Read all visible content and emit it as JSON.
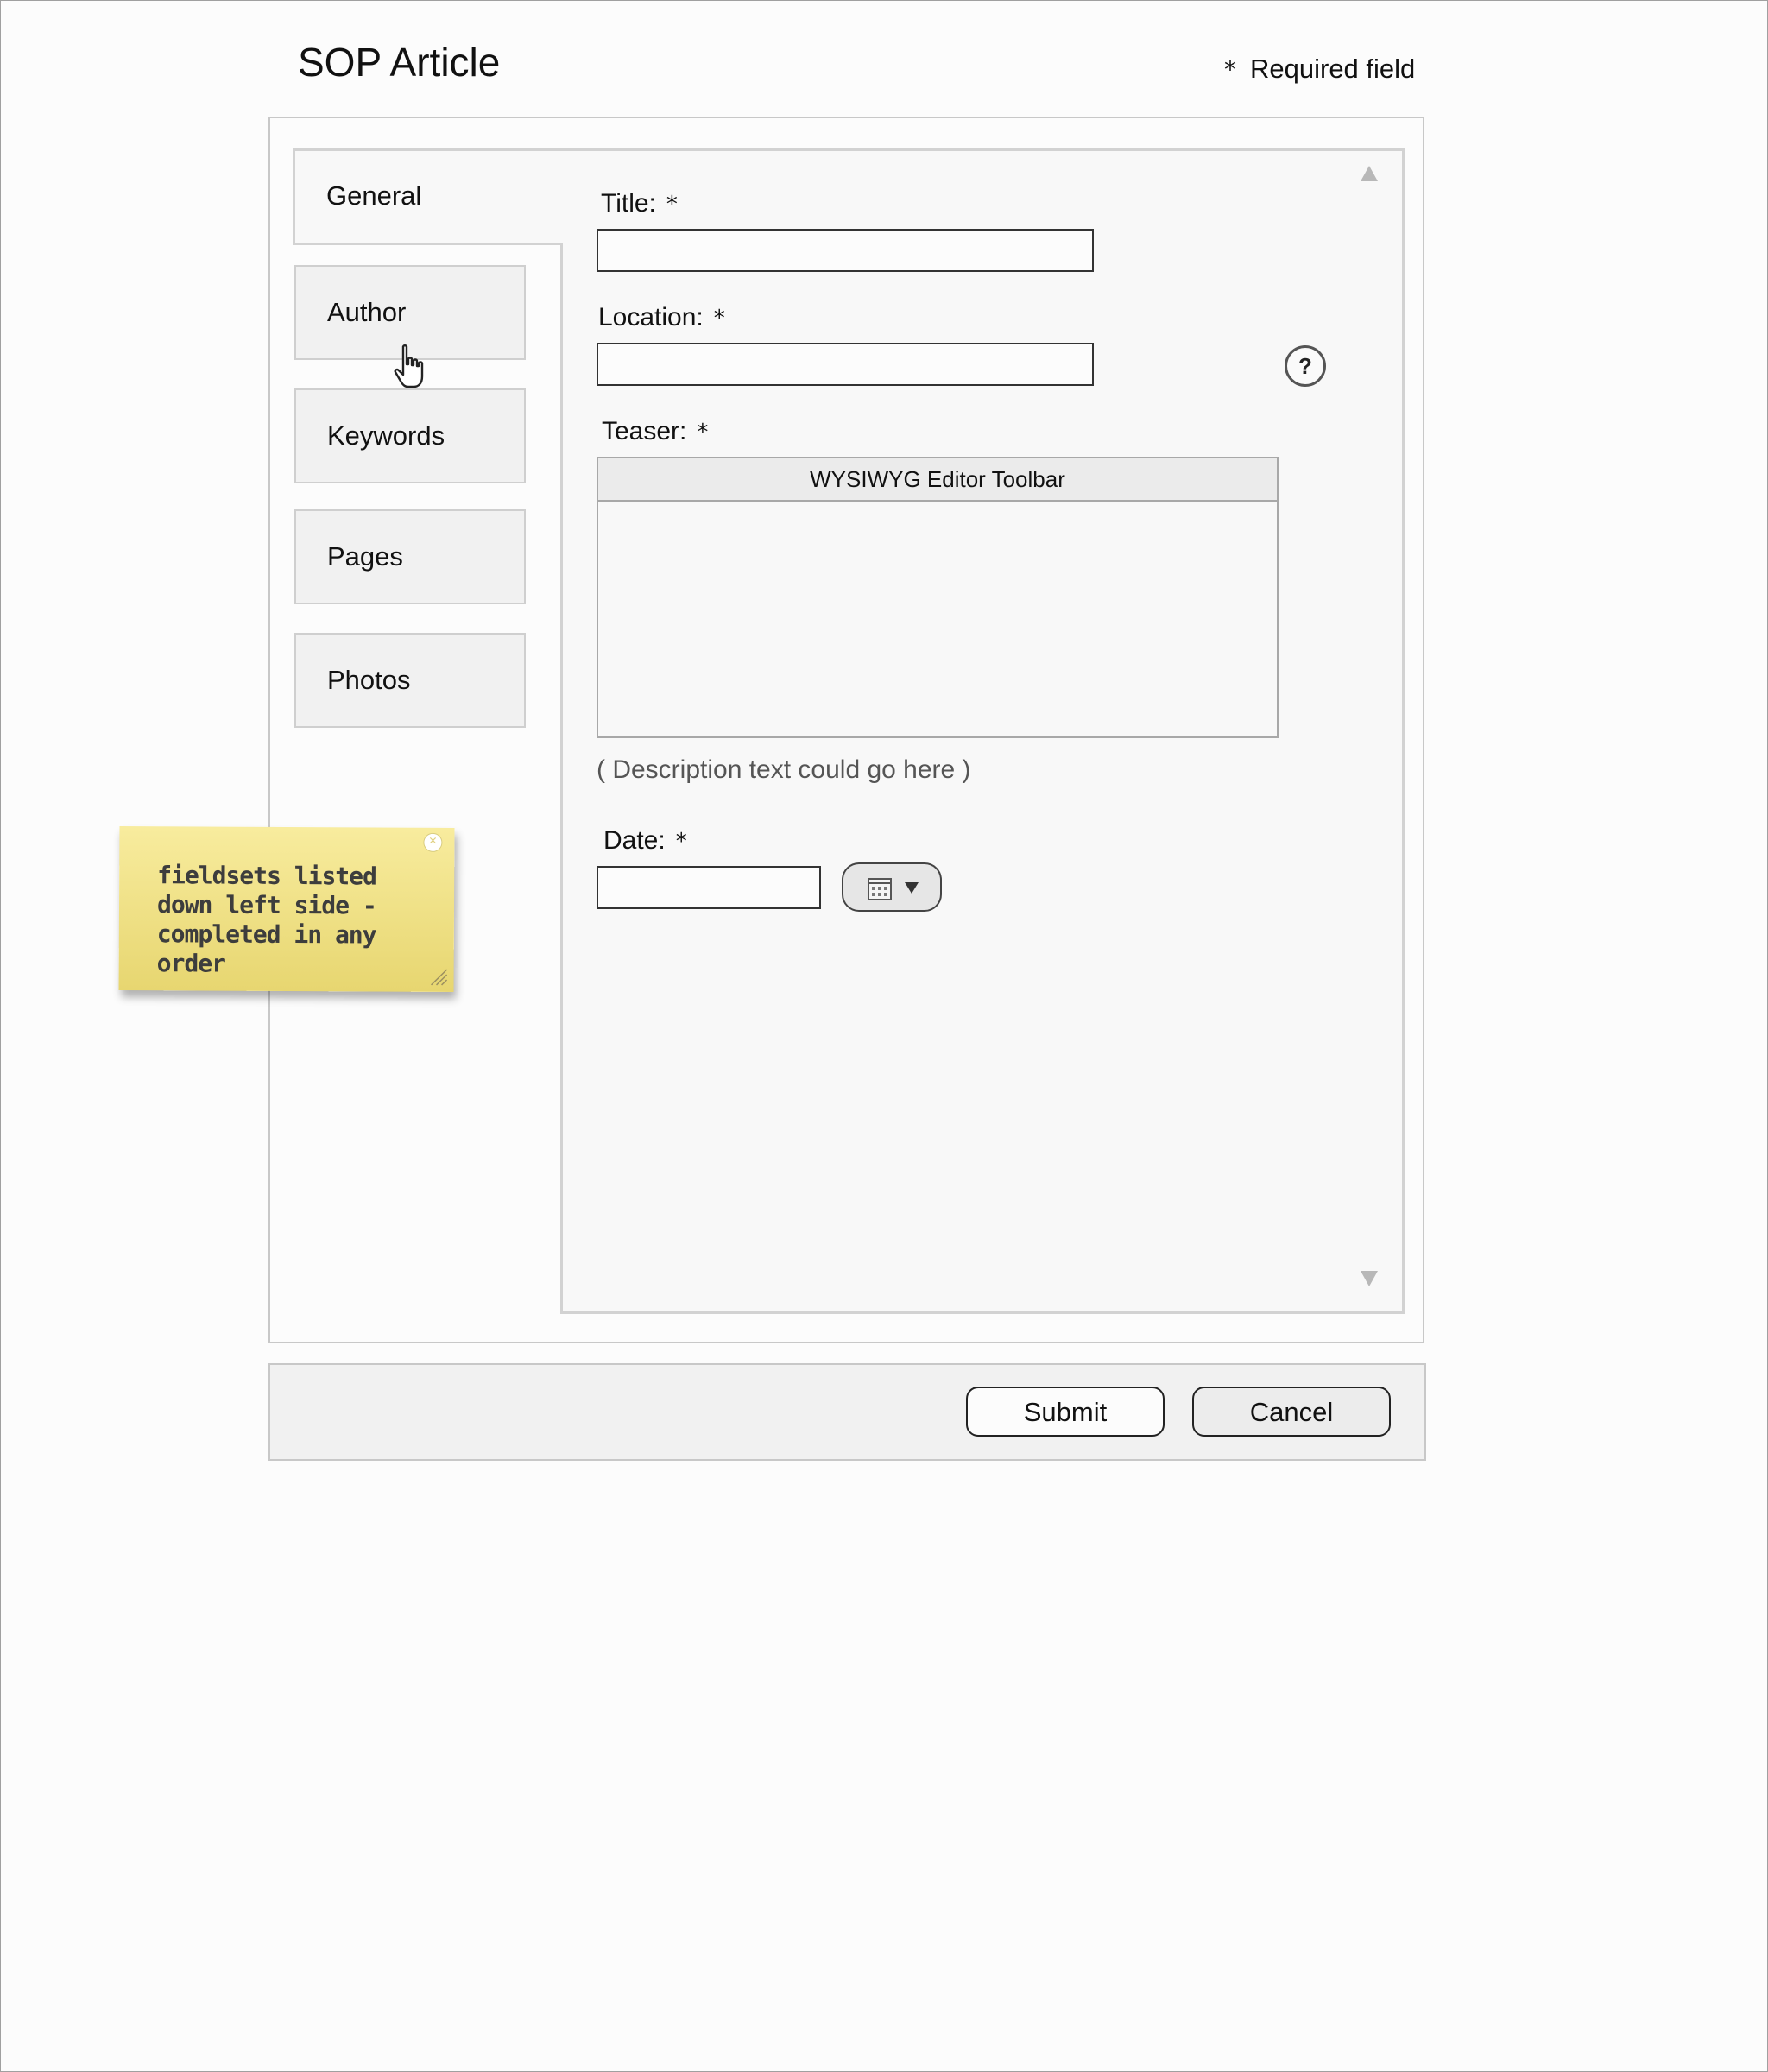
{
  "page": {
    "title": "SOP Article",
    "required_note_symbol": "*",
    "required_note": "Required field"
  },
  "tabs": [
    {
      "label": "General",
      "active": true
    },
    {
      "label": "Author",
      "active": false
    },
    {
      "label": "Keywords",
      "active": false
    },
    {
      "label": "Pages",
      "active": false
    },
    {
      "label": "Photos",
      "active": false
    }
  ],
  "form": {
    "title_label": "Title:",
    "title_value": "",
    "location_label": "Location:",
    "location_value": "",
    "teaser_label": "Teaser:",
    "editor_toolbar": "WYSIWYG Editor Toolbar",
    "description": "( Description text could go here )",
    "date_label": "Date:",
    "date_value": "",
    "required_symbol": "*",
    "help_symbol": "?"
  },
  "buttons": {
    "submit": "Submit",
    "cancel": "Cancel"
  },
  "sticky_note": {
    "text": "fieldsets listed down left side - completed in any order"
  },
  "icons": {
    "help": "question-mark-icon",
    "calendar": "calendar-icon",
    "caret": "caret-down-icon",
    "scroll_up": "scroll-up-arrow-icon",
    "scroll_down": "scroll-down-arrow-icon",
    "cursor": "hand-pointer-icon"
  }
}
